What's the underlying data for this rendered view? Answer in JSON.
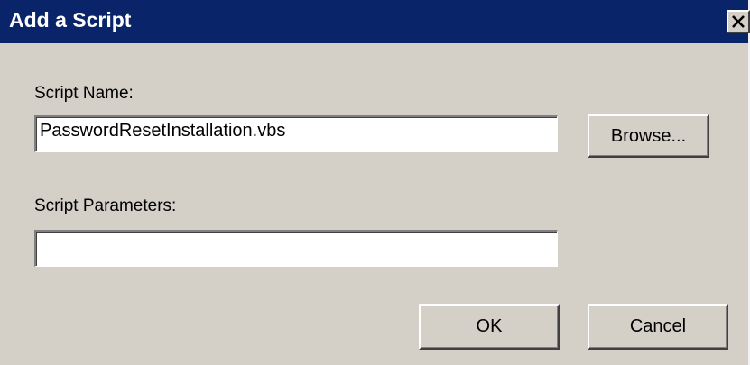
{
  "dialog": {
    "title": "Add a Script",
    "close_glyph": "✕"
  },
  "form": {
    "script_name_label": "Script Name:",
    "script_name_value": "PasswordResetInstallation.vbs",
    "script_params_label": "Script Parameters:",
    "script_params_value": ""
  },
  "buttons": {
    "browse": "Browse...",
    "ok": "OK",
    "cancel": "Cancel"
  },
  "colors": {
    "titlebar": "#0a246a",
    "face": "#d4d0c8"
  }
}
